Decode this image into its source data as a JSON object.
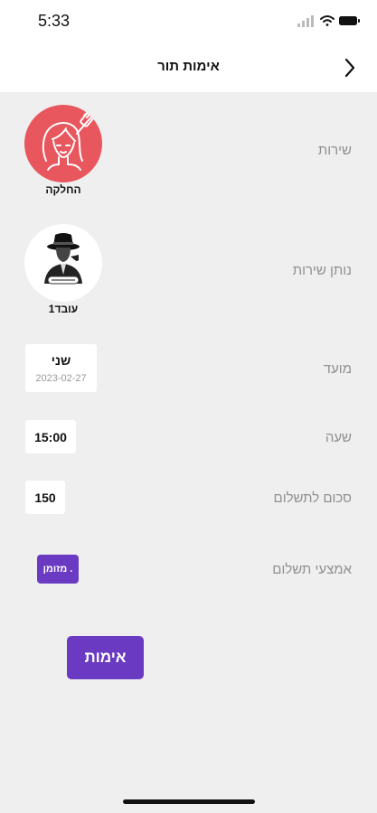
{
  "status": {
    "time": "5:33",
    "icons": [
      "signal-icon",
      "wifi-icon",
      "battery-icon"
    ]
  },
  "nav": {
    "title": "אימות תור",
    "back_icon": "chevron-right-icon"
  },
  "rows": {
    "service": {
      "label": "שירות",
      "value": "החלקה",
      "icon": "hair-brush-icon"
    },
    "provider": {
      "label": "נותן שירות",
      "value": "עובד1",
      "icon": "gentleman-avatar-icon"
    },
    "appointment": {
      "label": "מועד",
      "day": "שני",
      "date": "2023-02-27"
    },
    "hour": {
      "label": "שעה",
      "value": "15:00"
    },
    "amount": {
      "label": "סכום לתשלום",
      "value": "150"
    },
    "payment": {
      "label": "אמצעי תשלום",
      "value": "מזומן ."
    }
  },
  "actions": {
    "confirm_label": "אימות"
  },
  "colors": {
    "accent": "#6a3bc2",
    "service_circle": "#e8565e",
    "background": "#efefef"
  }
}
